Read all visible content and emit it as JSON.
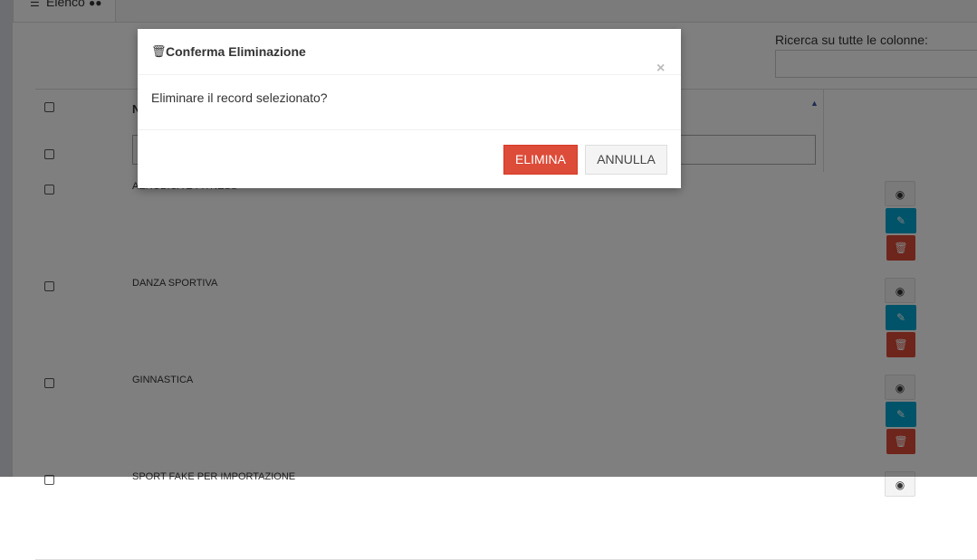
{
  "tab": {
    "label": "Elenco"
  },
  "search": {
    "label": "Ricerca su tutte le colonne:",
    "value": ""
  },
  "table": {
    "header_name": "N",
    "filter_value": "",
    "rows": [
      {
        "name": "AEROBICA E FITNESS"
      },
      {
        "name": "DANZA SPORTIVA"
      },
      {
        "name": "GINNASTICA"
      },
      {
        "name": "SPORT FAKE PER IMPORTAZIONE"
      }
    ]
  },
  "modal": {
    "title": "Conferma Eliminazione",
    "message": "Eliminare il record selezionato?",
    "close_glyph": "×",
    "confirm_label": "ELIMINA",
    "cancel_label": "ANNULLA"
  },
  "icons": {
    "list": "list-icon",
    "binoculars": "binoculars-icon",
    "trash": "trash-icon",
    "view": "eye-icon",
    "edit": "pencil-icon",
    "delete": "trash-icon"
  },
  "colors": {
    "danger": "#dd4b39",
    "info": "#00a7d0",
    "default_btn": "#f4f4f4"
  }
}
